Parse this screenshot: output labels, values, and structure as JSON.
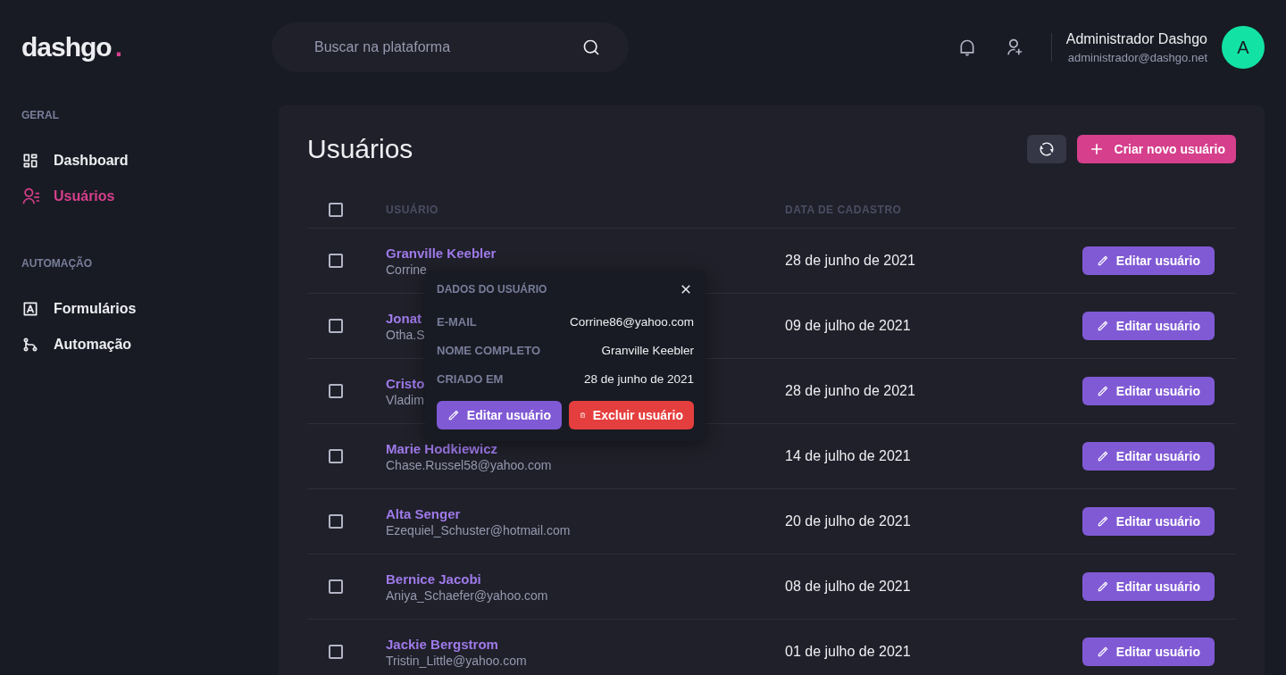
{
  "logo": {
    "name": "dashgo",
    "dot": "."
  },
  "search": {
    "placeholder": "Buscar na plataforma"
  },
  "profile": {
    "name": "Administrador Dashgo",
    "email": "administrador@dashgo.net",
    "initial": "A"
  },
  "sidebar": {
    "sections": [
      {
        "title": "GERAL",
        "items": [
          {
            "label": "Dashboard",
            "kind": "dashboard",
            "selected": false
          },
          {
            "label": "Usuários",
            "kind": "users",
            "selected": true
          }
        ]
      },
      {
        "title": "AUTOMAÇÃO",
        "items": [
          {
            "label": "Formulários",
            "kind": "forms",
            "selected": false
          },
          {
            "label": "Automação",
            "kind": "automation",
            "selected": false
          }
        ]
      }
    ]
  },
  "page": {
    "title": "Usuários",
    "create_button": "Criar novo usuário"
  },
  "table": {
    "select_all_checked": false,
    "columns": [
      "USUÁRIO",
      "DATA DE CADASTRO"
    ],
    "rows": [
      {
        "name": "Granville Keebler",
        "email": "Corrine",
        "date": "28 de junho de 2021",
        "action": "Editar usuário",
        "checked": false
      },
      {
        "name": "Jonat",
        "email": "Otha.S",
        "date": "09 de julho de 2021",
        "action": "Editar usuário",
        "checked": false
      },
      {
        "name": "Cristo",
        "email": "Vladim",
        "date": "28 de junho de 2021",
        "action": "Editar usuário",
        "checked": false
      },
      {
        "name": "Marie Hodkiewicz",
        "email": "Chase.Russel58@yahoo.com",
        "date": "14 de julho de 2021",
        "action": "Editar usuário",
        "checked": false
      },
      {
        "name": "Alta Senger",
        "email": "Ezequiel_Schuster@hotmail.com",
        "date": "20 de julho de 2021",
        "action": "Editar usuário",
        "checked": false
      },
      {
        "name": "Bernice Jacobi",
        "email": "Aniya_Schaefer@yahoo.com",
        "date": "08 de julho de 2021",
        "action": "Editar usuário",
        "checked": false
      },
      {
        "name": "Jackie Bergstrom",
        "email": "Tristin_Little@yahoo.com",
        "date": "01 de julho de 2021",
        "action": "Editar usuário",
        "checked": false
      }
    ]
  },
  "popover": {
    "title": "DADOS DO USUÁRIO",
    "fields": [
      {
        "label": "E-MAIL",
        "value": "Corrine86@yahoo.com"
      },
      {
        "label": "NOME COMPLETO",
        "value": "Granville Keebler"
      },
      {
        "label": "CRIADO EM",
        "value": "28 de junho de 2021"
      }
    ],
    "edit_button": "Editar usuário",
    "delete_button": "Excluir usuário"
  }
}
